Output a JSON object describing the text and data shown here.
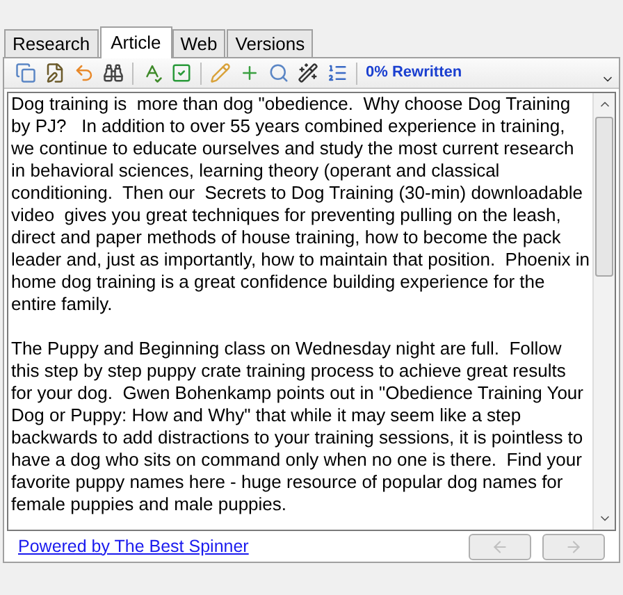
{
  "tabs": [
    {
      "label": "Research",
      "selected": false
    },
    {
      "label": "Article",
      "selected": true
    },
    {
      "label": "Web",
      "selected": false
    },
    {
      "label": "Versions",
      "selected": false
    }
  ],
  "toolbar": {
    "status": "0% Rewritten"
  },
  "article": {
    "paragraphs": [
      "Dog training is  more than dog \"obedience.  Why choose Dog Training by PJ?   In addition to over 55 years combined experience in training, we continue to educate ourselves and study the most current research in behavioral sciences, learning theory (operant and classical conditioning.  Then our  Secrets to Dog Training (30-min) downloadable video  gives you great techniques for preventing pulling on the leash, direct and paper methods of house training, how to become the pack leader and, just as importantly, how to maintain that position.  Phoenix in home dog training is a great confidence building experience for the entire family.",
      "The Puppy and Beginning class on Wednesday night are full.  Follow this step by step puppy crate training process to achieve great results for your dog.  Gwen Bohenkamp points out in \"Obedience Training Your Dog or Puppy: How and Why\" that while it may seem like a step backwards to add distractions to your training sessions, it is pointless to have a dog who sits on command only when no one is there.  Find your favorite puppy names here - huge resource of popular dog names for female puppies and male puppies."
    ]
  },
  "footer": {
    "link": "Powered by The Best Spinner",
    "buttons": [
      {
        "kind": "back",
        "disabled": true
      },
      {
        "kind": "forward",
        "disabled": true
      }
    ]
  }
}
